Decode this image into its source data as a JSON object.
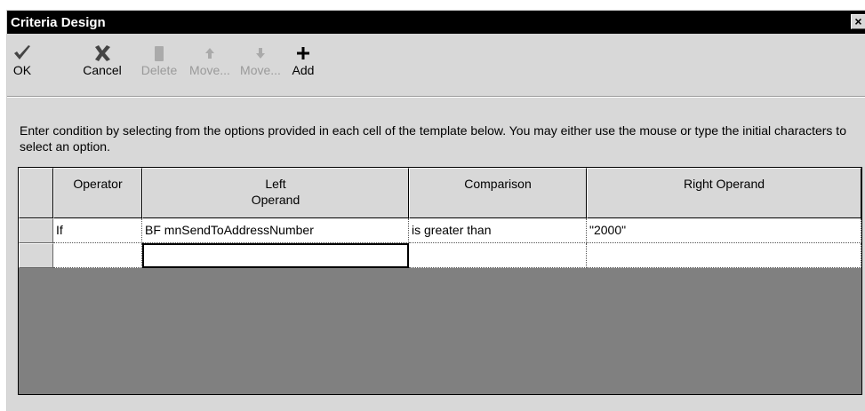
{
  "window": {
    "title": "Criteria Design",
    "close_label": "×"
  },
  "toolbar": {
    "buttons": [
      {
        "label": "OK",
        "icon": "check-icon",
        "enabled": true
      },
      {
        "label": "Cancel",
        "icon": "x-icon",
        "enabled": true
      },
      {
        "label": "Delete",
        "icon": "trash-icon",
        "enabled": false
      },
      {
        "label": "Move...",
        "icon": "arrow-up-icon",
        "enabled": false
      },
      {
        "label": "Move...",
        "icon": "arrow-down-icon",
        "enabled": false
      },
      {
        "label": "Add",
        "icon": "plus-icon",
        "enabled": true
      }
    ]
  },
  "instructions": "Enter condition by selecting from the options provided in each cell of the template below. You may either use the mouse or type the initial characters to select an option.",
  "grid": {
    "headers": [
      "",
      "Operator",
      "Left\nOperand",
      "Comparison",
      "Right Operand"
    ],
    "rows": [
      [
        "",
        "If",
        "BF mnSendToAddressNumber",
        "is greater than",
        "\"2000\""
      ],
      [
        "",
        "",
        "",
        "",
        ""
      ]
    ]
  }
}
